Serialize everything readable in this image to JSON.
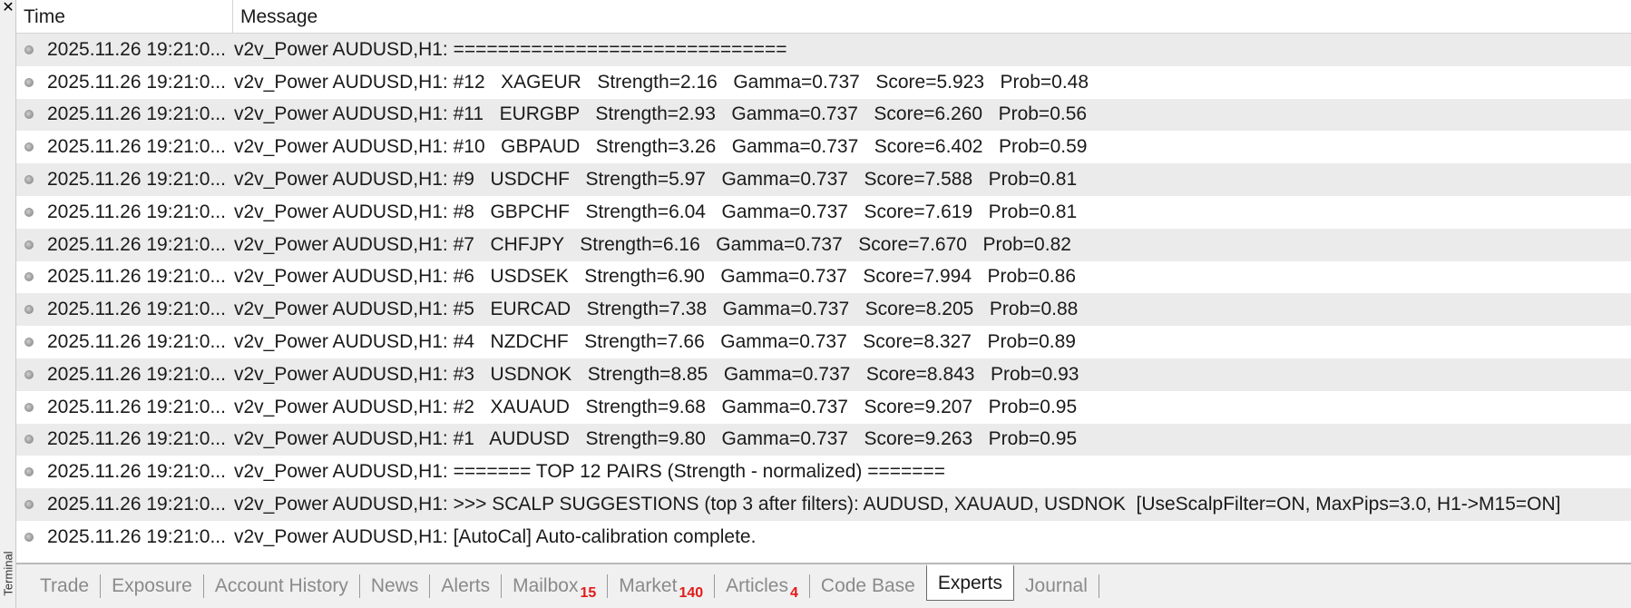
{
  "window": {
    "close_glyph": "✕",
    "side_label": "Terminal"
  },
  "columns": {
    "time": "Time",
    "message": "Message"
  },
  "rows": [
    {
      "time": "2025.11.26 19:21:0...",
      "message": "v2v_Power AUDUSD,H1: =============================="
    },
    {
      "time": "2025.11.26 19:21:0...",
      "message": "v2v_Power AUDUSD,H1: #12   XAGEUR   Strength=2.16   Gamma=0.737   Score=5.923   Prob=0.48"
    },
    {
      "time": "2025.11.26 19:21:0...",
      "message": "v2v_Power AUDUSD,H1: #11   EURGBP   Strength=2.93   Gamma=0.737   Score=6.260   Prob=0.56"
    },
    {
      "time": "2025.11.26 19:21:0...",
      "message": "v2v_Power AUDUSD,H1: #10   GBPAUD   Strength=3.26   Gamma=0.737   Score=6.402   Prob=0.59"
    },
    {
      "time": "2025.11.26 19:21:0...",
      "message": "v2v_Power AUDUSD,H1: #9   USDCHF   Strength=5.97   Gamma=0.737   Score=7.588   Prob=0.81"
    },
    {
      "time": "2025.11.26 19:21:0...",
      "message": "v2v_Power AUDUSD,H1: #8   GBPCHF   Strength=6.04   Gamma=0.737   Score=7.619   Prob=0.81"
    },
    {
      "time": "2025.11.26 19:21:0...",
      "message": "v2v_Power AUDUSD,H1: #7   CHFJPY   Strength=6.16   Gamma=0.737   Score=7.670   Prob=0.82"
    },
    {
      "time": "2025.11.26 19:21:0...",
      "message": "v2v_Power AUDUSD,H1: #6   USDSEK   Strength=6.90   Gamma=0.737   Score=7.994   Prob=0.86"
    },
    {
      "time": "2025.11.26 19:21:0...",
      "message": "v2v_Power AUDUSD,H1: #5   EURCAD   Strength=7.38   Gamma=0.737   Score=8.205   Prob=0.88"
    },
    {
      "time": "2025.11.26 19:21:0...",
      "message": "v2v_Power AUDUSD,H1: #4   NZDCHF   Strength=7.66   Gamma=0.737   Score=8.327   Prob=0.89"
    },
    {
      "time": "2025.11.26 19:21:0...",
      "message": "v2v_Power AUDUSD,H1: #3   USDNOK   Strength=8.85   Gamma=0.737   Score=8.843   Prob=0.93"
    },
    {
      "time": "2025.11.26 19:21:0...",
      "message": "v2v_Power AUDUSD,H1: #2   XAUAUD   Strength=9.68   Gamma=0.737   Score=9.207   Prob=0.95"
    },
    {
      "time": "2025.11.26 19:21:0...",
      "message": "v2v_Power AUDUSD,H1: #1   AUDUSD   Strength=9.80   Gamma=0.737   Score=9.263   Prob=0.95"
    },
    {
      "time": "2025.11.26 19:21:0...",
      "message": "v2v_Power AUDUSD,H1: ======= TOP 12 PAIRS (Strength - normalized) ======="
    },
    {
      "time": "2025.11.26 19:21:0...",
      "message": "v2v_Power AUDUSD,H1: >>> SCALP SUGGESTIONS (top 3 after filters): AUDUSD, XAUAUD, USDNOK  [UseScalpFilter=ON, MaxPips=3.0, H1->M15=ON]"
    },
    {
      "time": "2025.11.26 19:21:0...",
      "message": "v2v_Power AUDUSD,H1: [AutoCal] Auto-calibration complete."
    }
  ],
  "tabs": [
    {
      "label": "Trade",
      "badge": "",
      "active": false
    },
    {
      "label": "Exposure",
      "badge": "",
      "active": false
    },
    {
      "label": "Account History",
      "badge": "",
      "active": false
    },
    {
      "label": "News",
      "badge": "",
      "active": false
    },
    {
      "label": "Alerts",
      "badge": "",
      "active": false
    },
    {
      "label": "Mailbox",
      "badge": "15",
      "active": false
    },
    {
      "label": "Market",
      "badge": "140",
      "active": false
    },
    {
      "label": "Articles",
      "badge": "4",
      "active": false
    },
    {
      "label": "Code Base",
      "badge": "",
      "active": false
    },
    {
      "label": "Experts",
      "badge": "",
      "active": true
    },
    {
      "label": "Journal",
      "badge": "",
      "active": false
    }
  ],
  "colors": {
    "badge": "#e21a1a",
    "row_alt": "#ebebeb",
    "tab_inactive_text": "#8a8a8a"
  }
}
